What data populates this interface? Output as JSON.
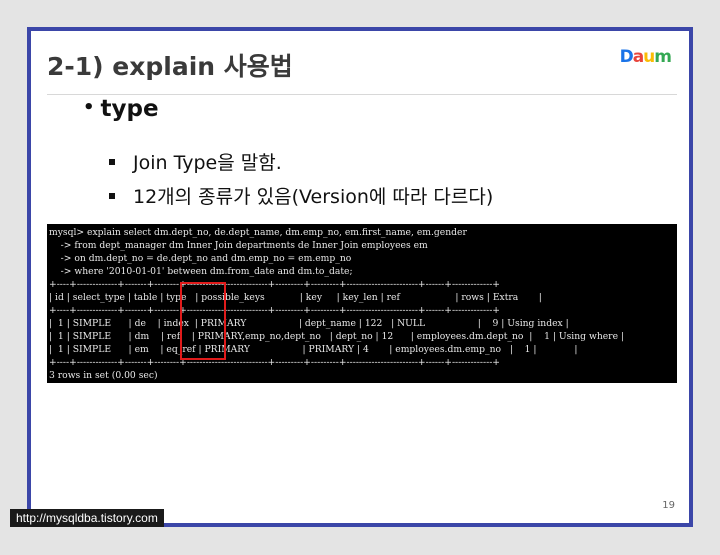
{
  "slide": {
    "title": "2-1) explain 사용법",
    "logo": {
      "text": "Daum",
      "colors": [
        "#1a73e8",
        "#e8453c",
        "#fbbc05",
        "#34a853"
      ]
    },
    "main_bullet": "type",
    "sub_bullets": [
      "Join Type을 말함.",
      "12개의 종류가 있음(Version에 따라 다르다)"
    ],
    "page_number": "19"
  },
  "terminal": {
    "lines": [
      "mysql> explain select dm.dept_no, de.dept_name, dm.emp_no, em.first_name, em.gender",
      "    -> from dept_manager dm Inner Join departments de Inner Join employees em",
      "    -> on dm.dept_no = de.dept_no and dm.emp_no = em.emp_no",
      "    -> where '2010-01-01' between dm.from_date and dm.to_date;",
      "+----+-------------+-------+--------+--------------------------+---------+---------+-----------------------+------+-------------+",
      "| id | select_type | table | type   | possible_keys            | key     | key_len | ref                   | rows | Extra       |",
      "+----+-------------+-------+--------+--------------------------+---------+---------+-----------------------+------+-------------+",
      "|  1 | SIMPLE      | de    | index  | PRIMARY                  | dept_name | 122   | NULL                  |    9 | Using index |",
      "|  1 | SIMPLE      | dm    | ref    | PRIMARY,emp_no,dept_no   | dept_no | 12      | employees.dm.dept_no  |    1 | Using where |",
      "|  1 | SIMPLE      | em    | eq_ref | PRIMARY                  | PRIMARY | 4       | employees.dm.emp_no   |    1 |             |",
      "+----+-------------+-------+--------+--------------------------+---------+---------+-----------------------+------+-------------+",
      "3 rows in set (0.00 sec)"
    ]
  },
  "watermark": "http://mysqldba.tistory.com"
}
